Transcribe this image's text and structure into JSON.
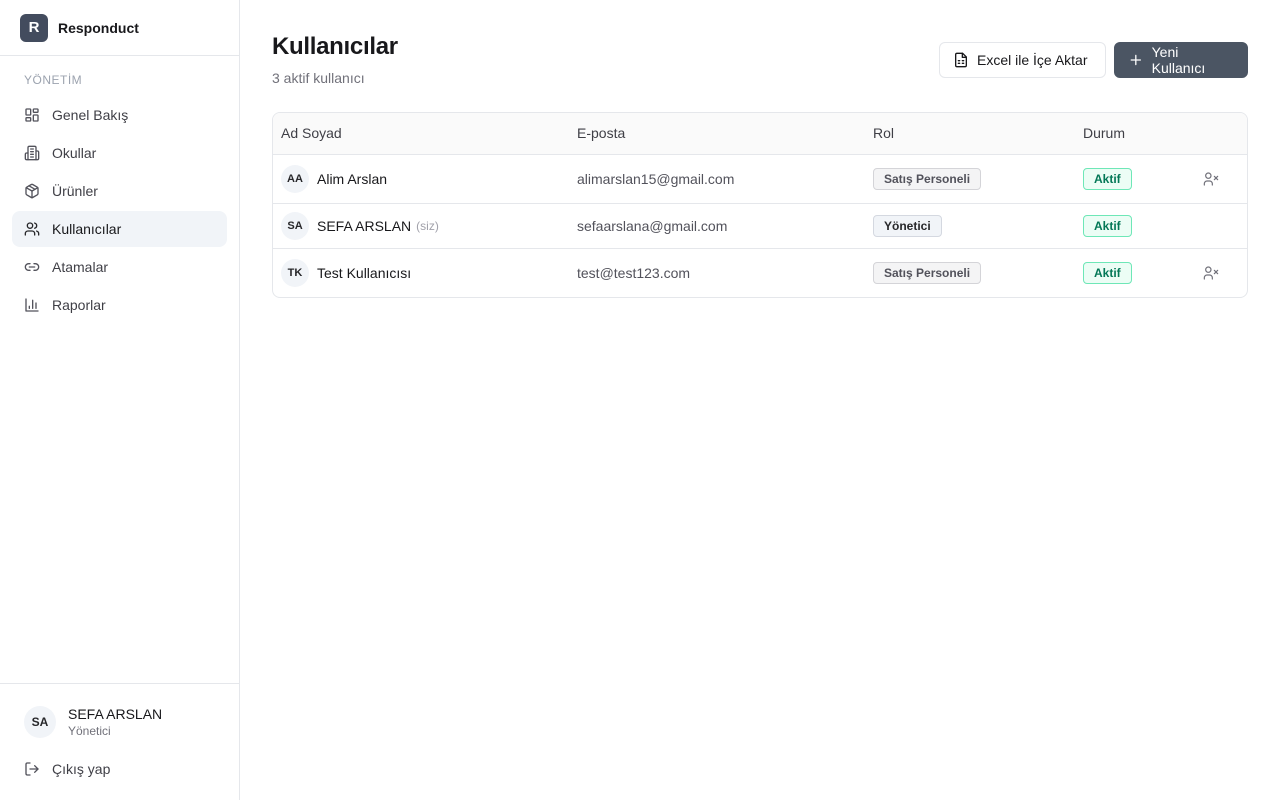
{
  "brand": {
    "logo_letter": "R",
    "name": "Responduct"
  },
  "sidebar": {
    "section_label": "YÖNETİM",
    "items": [
      {
        "label": "Genel Bakış",
        "icon": "dashboard-icon"
      },
      {
        "label": "Okullar",
        "icon": "building-icon"
      },
      {
        "label": "Ürünler",
        "icon": "package-icon"
      },
      {
        "label": "Kullanıcılar",
        "icon": "users-icon",
        "active": true
      },
      {
        "label": "Atamalar",
        "icon": "link-icon"
      },
      {
        "label": "Raporlar",
        "icon": "bar-chart-icon"
      }
    ]
  },
  "current_user": {
    "initials": "SA",
    "name": "SEFA ARSLAN",
    "role": "Yönetici"
  },
  "logout_label": "Çıkış yap",
  "page": {
    "title": "Kullanıcılar",
    "subtitle": "3 aktif kullanıcı",
    "import_button": "Excel ile İçe Aktar",
    "new_button": "Yeni Kullanıcı"
  },
  "table": {
    "columns": {
      "name": "Ad Soyad",
      "email": "E-posta",
      "role": "Rol",
      "status": "Durum"
    },
    "rows": [
      {
        "initials": "AA",
        "name": "Alim Arslan",
        "you": "",
        "email": "alimarslan15@gmail.com",
        "role": "Satış Personeli",
        "status": "Aktif"
      },
      {
        "initials": "SA",
        "name": "SEFA ARSLAN",
        "you": "(siz)",
        "email": "sefaarslana@gmail.com",
        "role": "Yönetici",
        "status": "Aktif"
      },
      {
        "initials": "TK",
        "name": "Test Kullanıcısı",
        "you": "",
        "email": "test@test123.com",
        "role": "Satış Personeli",
        "status": "Aktif"
      }
    ]
  },
  "colors": {
    "primary": "#4b5563",
    "active_nav_bg": "#f1f4f8",
    "status_green": "#047857"
  }
}
